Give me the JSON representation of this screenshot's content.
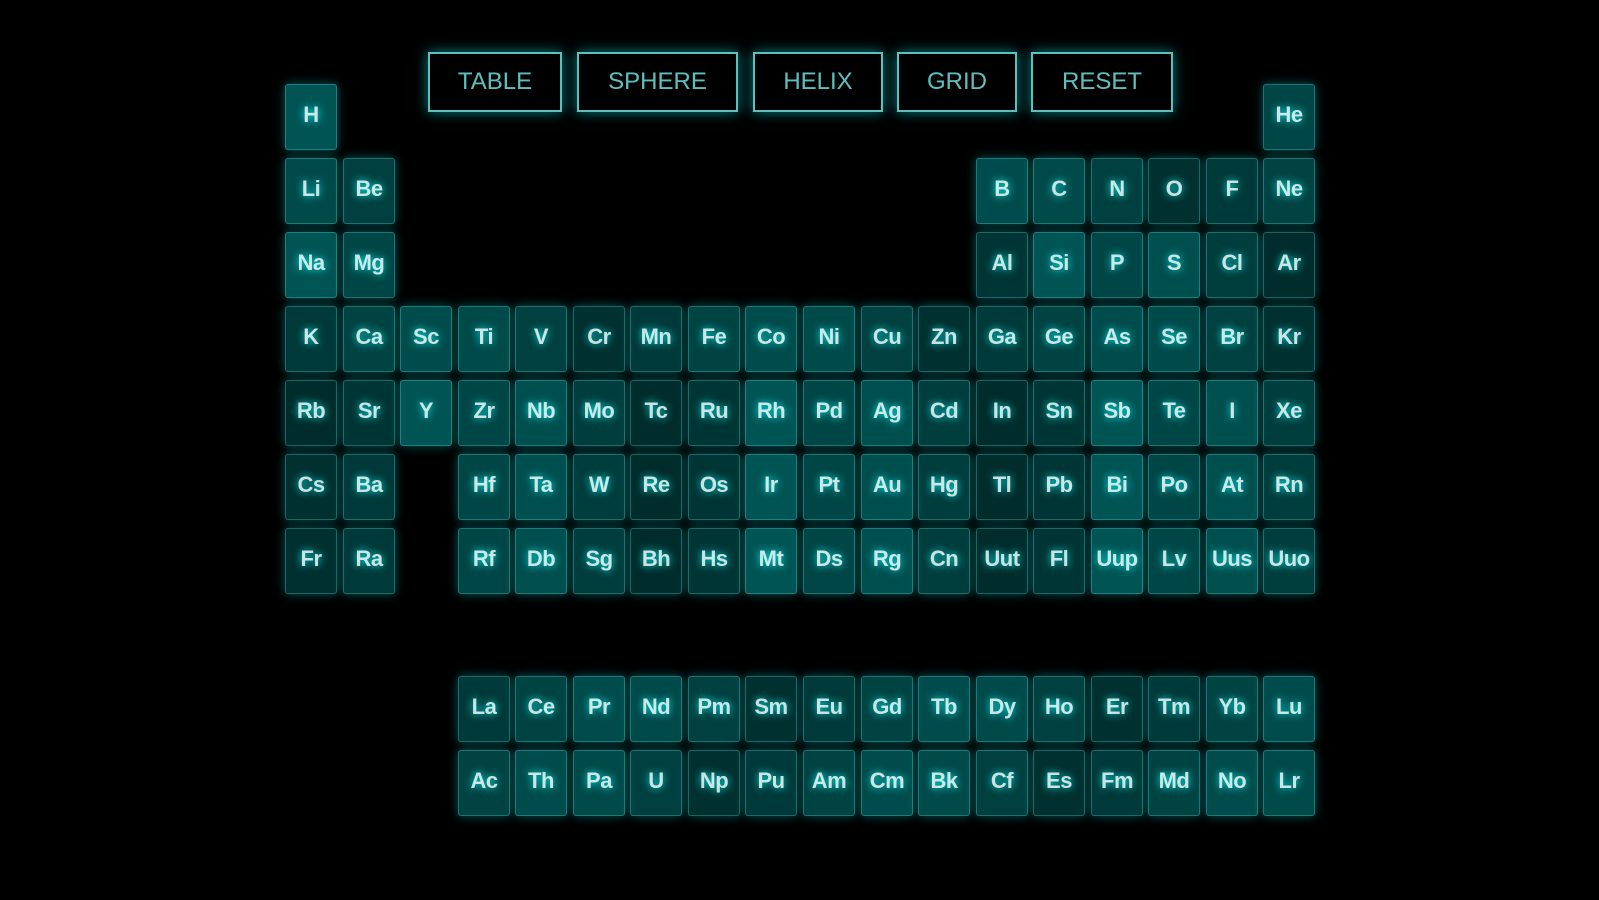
{
  "menu": {
    "buttons": [
      {
        "id": "table",
        "label": "TABLE"
      },
      {
        "id": "sphere",
        "label": "SPHERE"
      },
      {
        "id": "helix",
        "label": "HELIX"
      },
      {
        "id": "grid",
        "label": "GRID"
      },
      {
        "id": "reset",
        "label": "RESET"
      }
    ]
  },
  "colors": {
    "background": "#000000",
    "accent": "#7fffff",
    "tile_base": "#00ffff"
  },
  "elements": [
    {
      "symbol": "H",
      "col": 1,
      "row": 1
    },
    {
      "symbol": "He",
      "col": 18,
      "row": 1
    },
    {
      "symbol": "Li",
      "col": 1,
      "row": 2
    },
    {
      "symbol": "Be",
      "col": 2,
      "row": 2
    },
    {
      "symbol": "B",
      "col": 13,
      "row": 2
    },
    {
      "symbol": "C",
      "col": 14,
      "row": 2
    },
    {
      "symbol": "N",
      "col": 15,
      "row": 2
    },
    {
      "symbol": "O",
      "col": 16,
      "row": 2
    },
    {
      "symbol": "F",
      "col": 17,
      "row": 2
    },
    {
      "symbol": "Ne",
      "col": 18,
      "row": 2
    },
    {
      "symbol": "Na",
      "col": 1,
      "row": 3
    },
    {
      "symbol": "Mg",
      "col": 2,
      "row": 3
    },
    {
      "symbol": "Al",
      "col": 13,
      "row": 3
    },
    {
      "symbol": "Si",
      "col": 14,
      "row": 3
    },
    {
      "symbol": "P",
      "col": 15,
      "row": 3
    },
    {
      "symbol": "S",
      "col": 16,
      "row": 3
    },
    {
      "symbol": "Cl",
      "col": 17,
      "row": 3
    },
    {
      "symbol": "Ar",
      "col": 18,
      "row": 3
    },
    {
      "symbol": "K",
      "col": 1,
      "row": 4
    },
    {
      "symbol": "Ca",
      "col": 2,
      "row": 4
    },
    {
      "symbol": "Sc",
      "col": 3,
      "row": 4
    },
    {
      "symbol": "Ti",
      "col": 4,
      "row": 4
    },
    {
      "symbol": "V",
      "col": 5,
      "row": 4
    },
    {
      "symbol": "Cr",
      "col": 6,
      "row": 4
    },
    {
      "symbol": "Mn",
      "col": 7,
      "row": 4
    },
    {
      "symbol": "Fe",
      "col": 8,
      "row": 4
    },
    {
      "symbol": "Co",
      "col": 9,
      "row": 4
    },
    {
      "symbol": "Ni",
      "col": 10,
      "row": 4
    },
    {
      "symbol": "Cu",
      "col": 11,
      "row": 4
    },
    {
      "symbol": "Zn",
      "col": 12,
      "row": 4
    },
    {
      "symbol": "Ga",
      "col": 13,
      "row": 4
    },
    {
      "symbol": "Ge",
      "col": 14,
      "row": 4
    },
    {
      "symbol": "As",
      "col": 15,
      "row": 4
    },
    {
      "symbol": "Se",
      "col": 16,
      "row": 4
    },
    {
      "symbol": "Br",
      "col": 17,
      "row": 4
    },
    {
      "symbol": "Kr",
      "col": 18,
      "row": 4
    },
    {
      "symbol": "Rb",
      "col": 1,
      "row": 5
    },
    {
      "symbol": "Sr",
      "col": 2,
      "row": 5
    },
    {
      "symbol": "Y",
      "col": 3,
      "row": 5
    },
    {
      "symbol": "Zr",
      "col": 4,
      "row": 5
    },
    {
      "symbol": "Nb",
      "col": 5,
      "row": 5
    },
    {
      "symbol": "Mo",
      "col": 6,
      "row": 5
    },
    {
      "symbol": "Tc",
      "col": 7,
      "row": 5
    },
    {
      "symbol": "Ru",
      "col": 8,
      "row": 5
    },
    {
      "symbol": "Rh",
      "col": 9,
      "row": 5
    },
    {
      "symbol": "Pd",
      "col": 10,
      "row": 5
    },
    {
      "symbol": "Ag",
      "col": 11,
      "row": 5
    },
    {
      "symbol": "Cd",
      "col": 12,
      "row": 5
    },
    {
      "symbol": "In",
      "col": 13,
      "row": 5
    },
    {
      "symbol": "Sn",
      "col": 14,
      "row": 5
    },
    {
      "symbol": "Sb",
      "col": 15,
      "row": 5
    },
    {
      "symbol": "Te",
      "col": 16,
      "row": 5
    },
    {
      "symbol": "I",
      "col": 17,
      "row": 5
    },
    {
      "symbol": "Xe",
      "col": 18,
      "row": 5
    },
    {
      "symbol": "Cs",
      "col": 1,
      "row": 6
    },
    {
      "symbol": "Ba",
      "col": 2,
      "row": 6
    },
    {
      "symbol": "Hf",
      "col": 4,
      "row": 6
    },
    {
      "symbol": "Ta",
      "col": 5,
      "row": 6
    },
    {
      "symbol": "W",
      "col": 6,
      "row": 6
    },
    {
      "symbol": "Re",
      "col": 7,
      "row": 6
    },
    {
      "symbol": "Os",
      "col": 8,
      "row": 6
    },
    {
      "symbol": "Ir",
      "col": 9,
      "row": 6
    },
    {
      "symbol": "Pt",
      "col": 10,
      "row": 6
    },
    {
      "symbol": "Au",
      "col": 11,
      "row": 6
    },
    {
      "symbol": "Hg",
      "col": 12,
      "row": 6
    },
    {
      "symbol": "Tl",
      "col": 13,
      "row": 6
    },
    {
      "symbol": "Pb",
      "col": 14,
      "row": 6
    },
    {
      "symbol": "Bi",
      "col": 15,
      "row": 6
    },
    {
      "symbol": "Po",
      "col": 16,
      "row": 6
    },
    {
      "symbol": "At",
      "col": 17,
      "row": 6
    },
    {
      "symbol": "Rn",
      "col": 18,
      "row": 6
    },
    {
      "symbol": "Fr",
      "col": 1,
      "row": 7
    },
    {
      "symbol": "Ra",
      "col": 2,
      "row": 7
    },
    {
      "symbol": "Rf",
      "col": 4,
      "row": 7
    },
    {
      "symbol": "Db",
      "col": 5,
      "row": 7
    },
    {
      "symbol": "Sg",
      "col": 6,
      "row": 7
    },
    {
      "symbol": "Bh",
      "col": 7,
      "row": 7
    },
    {
      "symbol": "Hs",
      "col": 8,
      "row": 7
    },
    {
      "symbol": "Mt",
      "col": 9,
      "row": 7
    },
    {
      "symbol": "Ds",
      "col": 10,
      "row": 7
    },
    {
      "symbol": "Rg",
      "col": 11,
      "row": 7
    },
    {
      "symbol": "Cn",
      "col": 12,
      "row": 7
    },
    {
      "symbol": "Uut",
      "col": 13,
      "row": 7
    },
    {
      "symbol": "Fl",
      "col": 14,
      "row": 7
    },
    {
      "symbol": "Uup",
      "col": 15,
      "row": 7
    },
    {
      "symbol": "Lv",
      "col": 16,
      "row": 7
    },
    {
      "symbol": "Uus",
      "col": 17,
      "row": 7
    },
    {
      "symbol": "Uuo",
      "col": 18,
      "row": 7
    },
    {
      "symbol": "La",
      "col": 4,
      "row": 9
    },
    {
      "symbol": "Ce",
      "col": 5,
      "row": 9
    },
    {
      "symbol": "Pr",
      "col": 6,
      "row": 9
    },
    {
      "symbol": "Nd",
      "col": 7,
      "row": 9
    },
    {
      "symbol": "Pm",
      "col": 8,
      "row": 9
    },
    {
      "symbol": "Sm",
      "col": 9,
      "row": 9
    },
    {
      "symbol": "Eu",
      "col": 10,
      "row": 9
    },
    {
      "symbol": "Gd",
      "col": 11,
      "row": 9
    },
    {
      "symbol": "Tb",
      "col": 12,
      "row": 9
    },
    {
      "symbol": "Dy",
      "col": 13,
      "row": 9
    },
    {
      "symbol": "Ho",
      "col": 14,
      "row": 9
    },
    {
      "symbol": "Er",
      "col": 15,
      "row": 9
    },
    {
      "symbol": "Tm",
      "col": 16,
      "row": 9
    },
    {
      "symbol": "Yb",
      "col": 17,
      "row": 9
    },
    {
      "symbol": "Lu",
      "col": 18,
      "row": 9
    },
    {
      "symbol": "Ac",
      "col": 4,
      "row": 10
    },
    {
      "symbol": "Th",
      "col": 5,
      "row": 10
    },
    {
      "symbol": "Pa",
      "col": 6,
      "row": 10
    },
    {
      "symbol": "U",
      "col": 7,
      "row": 10
    },
    {
      "symbol": "Np",
      "col": 8,
      "row": 10
    },
    {
      "symbol": "Pu",
      "col": 9,
      "row": 10
    },
    {
      "symbol": "Am",
      "col": 10,
      "row": 10
    },
    {
      "symbol": "Cm",
      "col": 11,
      "row": 10
    },
    {
      "symbol": "Bk",
      "col": 12,
      "row": 10
    },
    {
      "symbol": "Cf",
      "col": 13,
      "row": 10
    },
    {
      "symbol": "Es",
      "col": 14,
      "row": 10
    },
    {
      "symbol": "Fm",
      "col": 15,
      "row": 10
    },
    {
      "symbol": "Md",
      "col": 16,
      "row": 10
    },
    {
      "symbol": "No",
      "col": 17,
      "row": 10
    },
    {
      "symbol": "Lr",
      "col": 18,
      "row": 10
    }
  ]
}
